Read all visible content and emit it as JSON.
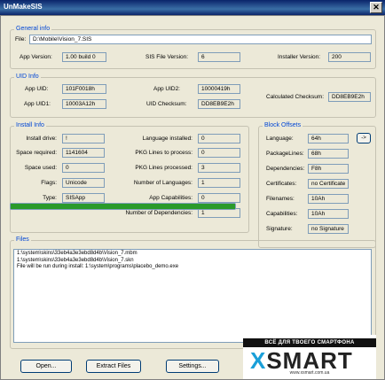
{
  "window": {
    "title": "UnMakeSIS"
  },
  "general": {
    "title": "General info",
    "file_label": "File:",
    "file_value": "D:\\Mobile\\Vision_7.SIS",
    "app_version_label": "App Version:",
    "app_version_value": "1.00 build 0",
    "sis_version_label": "SIS File Version:",
    "sis_version_value": "6",
    "installer_version_label": "Installer Version:",
    "installer_version_value": "200"
  },
  "uid": {
    "title": "UID Info",
    "app_uid_label": "App UID:",
    "app_uid_value": "101F0018h",
    "app_uid1_label": "App UID1:",
    "app_uid1_value": "10003A12h",
    "app_uid2_label": "App UID2:",
    "app_uid2_value": "10000419h",
    "uid_checksum_label": "UID Checksum:",
    "uid_checksum_value": "DD8EB9E2h",
    "calc_checksum_label": "Calculated Checksum:",
    "calc_checksum_value": "DD8EB9E2h"
  },
  "install": {
    "title": "Install Info",
    "install_drive_label": "Install drive:",
    "install_drive_value": "!",
    "space_required_label": "Space required:",
    "space_required_value": "1141604",
    "space_used_label": "Space used:",
    "space_used_value": "0",
    "flags_label": "Flags:",
    "flags_value": "Unicode",
    "type_label": "Type:",
    "type_value": "SISApp",
    "lang_installed_label": "Language installed:",
    "lang_installed_value": "0",
    "pkg_to_process_label": "PKG Lines to process:",
    "pkg_to_process_value": "0",
    "pkg_processed_label": "PKG Lines processed:",
    "pkg_processed_value": "3",
    "num_languages_label": "Number of Languages:",
    "num_languages_value": "1",
    "app_capabilities_label": "App Capabilities:",
    "app_capabilities_value": "0",
    "num_dependencies_label": "Number of Dependencies:",
    "num_dependencies_value": "1"
  },
  "block": {
    "title": "Block Offsets",
    "language_label": "Language:",
    "language_value": "64h",
    "arrow_button": "->",
    "package_lines_label": "PackageLines:",
    "package_lines_value": "68h",
    "dependencies_label": "Dependencies:",
    "dependencies_value": "F8h",
    "certificates_label": "Certificates:",
    "certificates_value": "no Certificate",
    "filenames_label": "Filenames:",
    "filenames_value": "10Ah",
    "capabilities_label": "Capabilities:",
    "capabilities_value": "10Ah",
    "signature_label": "Signature:",
    "signature_value": "no Signature"
  },
  "progress": {
    "fraction": 1.0
  },
  "files": {
    "title": "Files",
    "lines": [
      "1:\\system\\skins\\33eb4a3e3ebd8d4b\\Vision_7.mbm",
      "1:\\system\\skins\\33eb4a3e3ebd8d4b\\Vision_7.skn",
      "File will be run during install: 1:\\system\\programs\\placebo_demo.exe"
    ]
  },
  "buttons": {
    "open": "Open...",
    "extract": "Extract Files",
    "settings": "Settings..."
  },
  "watermark": {
    "banner": "ВСЁ ДЛЯ ТВОЕГО СМАРТФОНА",
    "logo_x": "X",
    "logo_rest": "SMART",
    "url": "www.xsmart.com.ua"
  }
}
